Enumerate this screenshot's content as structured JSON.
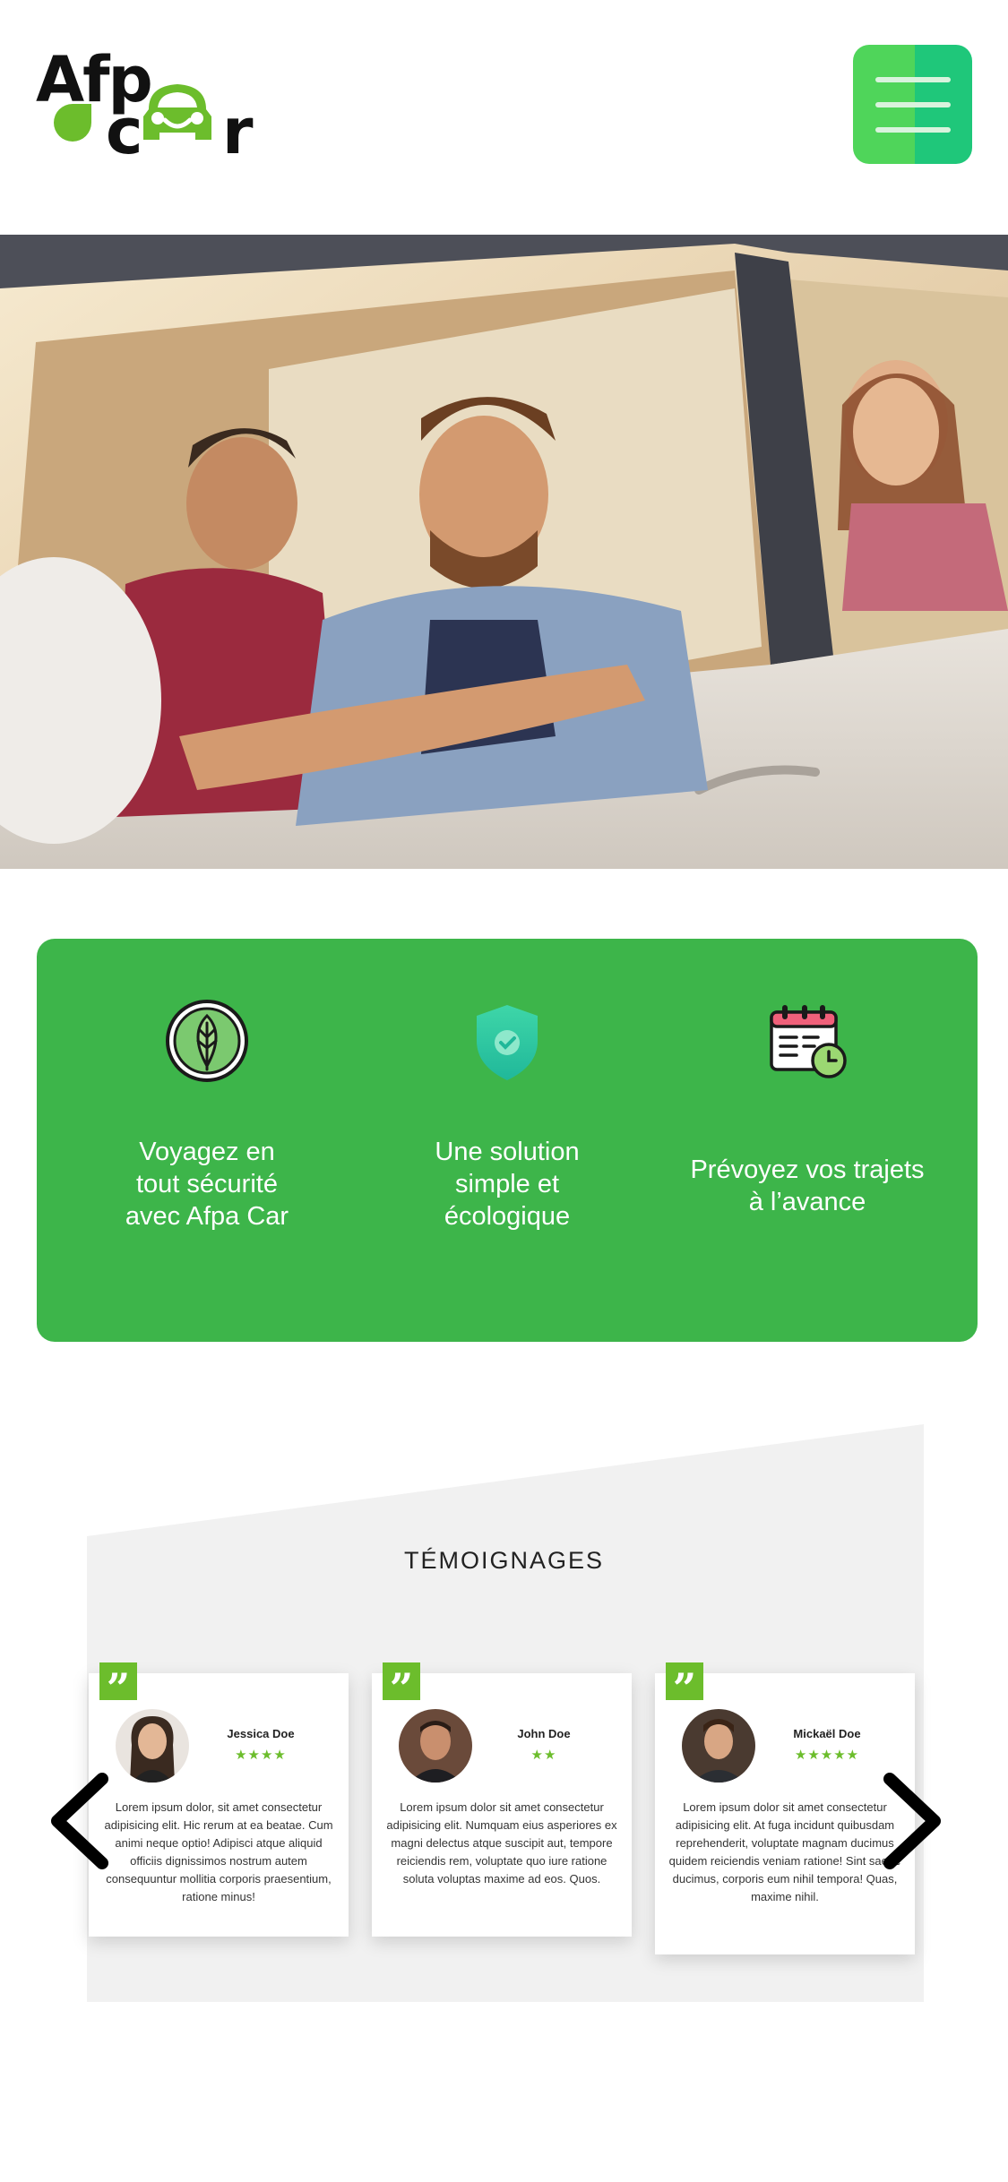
{
  "header": {
    "logo_text_afp": "Afp",
    "logo_text_c": "c",
    "logo_text_r": "r",
    "menu_icon": "hamburger-menu-icon",
    "menu_colors": [
      "#4fd55a",
      "#1fc77a"
    ]
  },
  "hero": {
    "image": "people-in-car-photo"
  },
  "features": {
    "background": "#3db54a",
    "items": [
      {
        "icon": "leaf-badge-icon",
        "text": "Voyagez en\ntout sécurité\navec Afpa Car"
      },
      {
        "icon": "shield-check-icon",
        "text": "Une solution\nsimple et\nécologique"
      },
      {
        "icon": "calendar-clock-icon",
        "text": "Prévoyez vos trajets\nà l’avance"
      }
    ]
  },
  "testimonials": {
    "title": "TÉMOIGNAGES",
    "accent": "#6cbd2c",
    "quote_mark": "”",
    "cards": [
      {
        "name": "Jessica Doe",
        "stars": "★★★★",
        "rating": 4,
        "text": "Lorem ipsum dolor, sit amet consectetur adipisicing elit. Hic rerum at ea beatae. Cum animi neque optio! Adipisci atque aliquid officiis dignissimos nostrum autem consequuntur mollitia corporis praesentium, ratione minus!"
      },
      {
        "name": "John Doe",
        "stars": "★★",
        "rating": 2,
        "text": "Lorem ipsum dolor sit amet consectetur adipisicing elit. Numquam eius asperiores ex magni delectus atque suscipit aut, tempore reiciendis rem, voluptate quo iure ratione soluta voluptas maxime ad eos. Quos."
      },
      {
        "name": "Mickaël Doe",
        "stars": "★★★★★",
        "rating": 5,
        "text": "Lorem ipsum dolor sit amet consectetur adipisicing elit. At fuga incidunt quibusdam reprehenderit, voluptate magnam ducimus quidem reiciendis veniam ratione! Sint saepe ducimus, corporis eum nihil tempora! Quas, maxime nihil."
      }
    ],
    "prev_icon": "chevron-left-icon",
    "next_icon": "chevron-right-icon"
  }
}
